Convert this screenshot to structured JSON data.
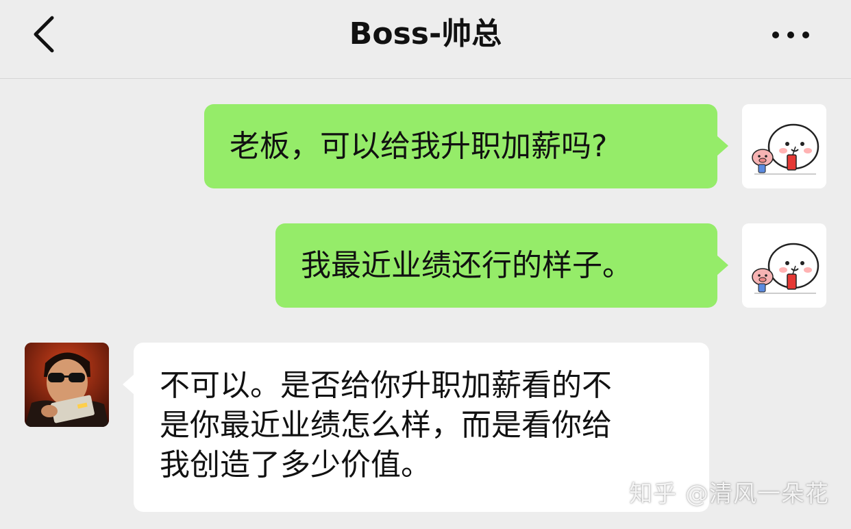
{
  "header": {
    "title": "Boss-帅总",
    "back_icon": "chevron-left-icon",
    "more_icon": "more-dots-icon"
  },
  "messages": [
    {
      "direction": "outgoing",
      "text": "老板，可以给我升职加薪吗?"
    },
    {
      "direction": "outgoing",
      "text": "我最近业绩还行的样子。"
    },
    {
      "direction": "incoming",
      "lines": [
        "不可以。是否给你升职加薪看的不",
        "是你最近业绩怎么样，而是看你给",
        "我创造了多少价值。"
      ]
    }
  ],
  "watermark": "知乎 @清风一朵花",
  "colors": {
    "background": "#ededed",
    "outgoing_bubble": "#95ec69",
    "incoming_bubble": "#ffffff"
  }
}
